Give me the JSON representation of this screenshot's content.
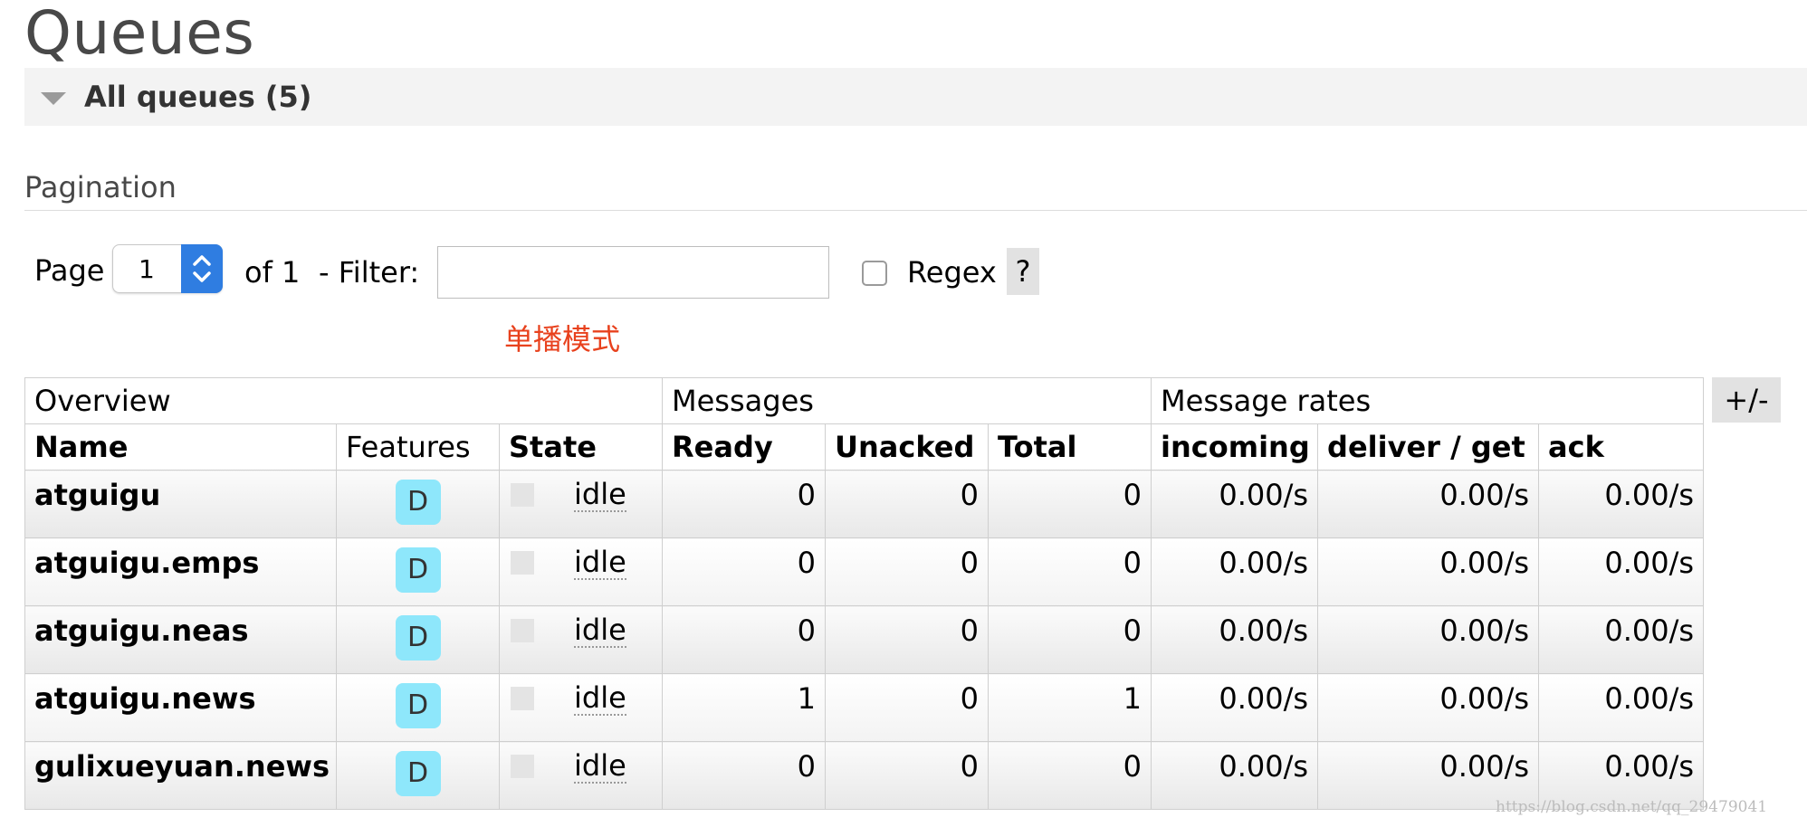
{
  "page_title": "Queues",
  "section": {
    "label": "All queues (5)"
  },
  "pagination": {
    "heading": "Pagination",
    "page_label": "Page",
    "page_value": "1",
    "of_label": "of 1",
    "filter_label": "- Filter:",
    "filter_value": "",
    "regex_label": "Regex",
    "help_label": "?"
  },
  "annotation": "单播模式",
  "table": {
    "groups": [
      "Overview",
      "Messages",
      "Message rates"
    ],
    "columns": [
      "Name",
      "Features",
      "State",
      "Ready",
      "Unacked",
      "Total",
      "incoming",
      "deliver / get",
      "ack"
    ],
    "rows": [
      {
        "name": "atguigu",
        "feature": "D",
        "state": "idle",
        "ready": "0",
        "unacked": "0",
        "total": "0",
        "incoming": "0.00/s",
        "deliver_get": "0.00/s",
        "ack": "0.00/s"
      },
      {
        "name": "atguigu.emps",
        "feature": "D",
        "state": "idle",
        "ready": "0",
        "unacked": "0",
        "total": "0",
        "incoming": "0.00/s",
        "deliver_get": "0.00/s",
        "ack": "0.00/s"
      },
      {
        "name": "atguigu.neas",
        "feature": "D",
        "state": "idle",
        "ready": "0",
        "unacked": "0",
        "total": "0",
        "incoming": "0.00/s",
        "deliver_get": "0.00/s",
        "ack": "0.00/s"
      },
      {
        "name": "atguigu.news",
        "feature": "D",
        "state": "idle",
        "ready": "1",
        "unacked": "0",
        "total": "1",
        "incoming": "0.00/s",
        "deliver_get": "0.00/s",
        "ack": "0.00/s"
      },
      {
        "name": "gulixueyuan.news",
        "feature": "D",
        "state": "idle",
        "ready": "0",
        "unacked": "0",
        "total": "0",
        "incoming": "0.00/s",
        "deliver_get": "0.00/s",
        "ack": "0.00/s"
      }
    ],
    "column_toggle_label": "+/-"
  },
  "watermark": "https://blog.csdn.net/qq_29479041",
  "colors": {
    "accent": "#2f7de1",
    "badge": "#8ee7fb",
    "annotation": "#e8411d"
  }
}
